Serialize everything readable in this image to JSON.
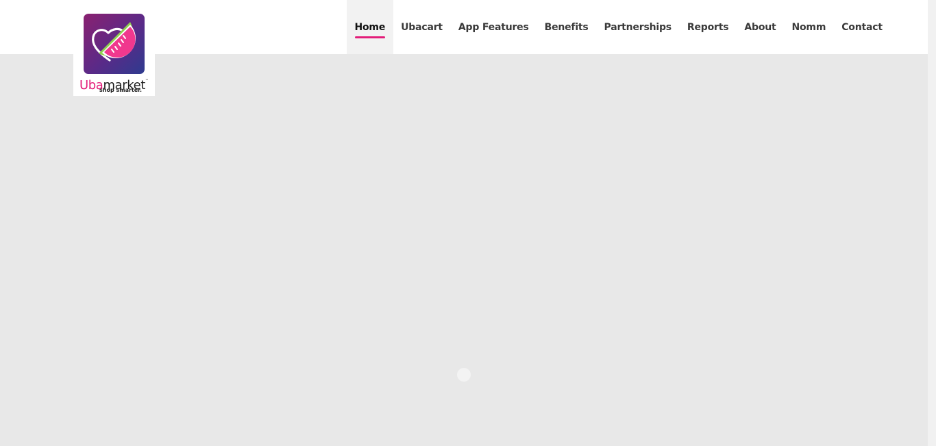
{
  "brand": {
    "name_part1": "Uba",
    "name_part2": "market",
    "trademark": "™",
    "tagline": "shop smarter.",
    "accent_color": "#e31c79"
  },
  "nav": {
    "items": [
      {
        "label": "Home",
        "active": true
      },
      {
        "label": "Ubacart"
      },
      {
        "label": "App Features"
      },
      {
        "label": "Benefits"
      },
      {
        "label": "Partnerships"
      },
      {
        "label": "Reports"
      },
      {
        "label": "About"
      },
      {
        "label": "Nomm"
      },
      {
        "label": "Contact"
      }
    ]
  },
  "icons": {
    "logo": "watermelon-slice-icon",
    "loader": "loading-dot-icon"
  }
}
